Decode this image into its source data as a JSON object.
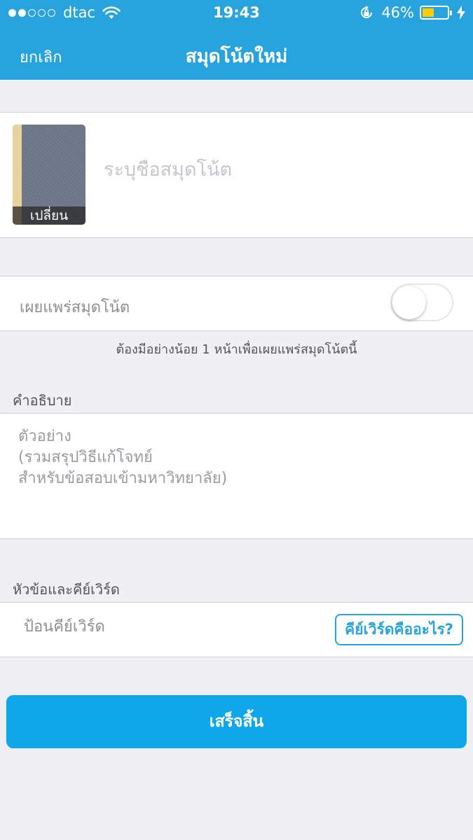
{
  "status_bar": {
    "carrier": "dtac",
    "time": "19:43",
    "battery_percent": "46%",
    "battery_level": 0.46,
    "signal_bars_filled": 2,
    "signal_bars_total": 5
  },
  "nav": {
    "cancel_label": "ยกเลิก",
    "title": "สมุดโน้ตใหม่"
  },
  "cover": {
    "change_label": "เปลี่ยน"
  },
  "notebook_name": {
    "value": "",
    "placeholder": "ระบุชื่อสมุดโน้ต"
  },
  "publish": {
    "label": "เผยแพร่สมุดโน้ต",
    "enabled": false,
    "hint": "ต้องมีอย่างน้อย 1 หน้าเพื่อเผยแพร่สมุดโน้ตนี้"
  },
  "description": {
    "header": "คำอธิบาย",
    "value": "",
    "placeholder": "ตัวอย่าง\n(รวมสรุปวิธีแก้โจทย์\nสำหรับข้อสอบเข้ามหาวิทยาลัย)"
  },
  "keywords": {
    "header": "หัวข้อและคีย์เวิร์ด",
    "value": "",
    "placeholder": "ป้อนคีย์เวิร์ด",
    "help_label": "คีย์เวิร์ดคืออะไร?"
  },
  "done_label": "เสร็จสิ้น",
  "colors": {
    "header_bg": "#27a3de",
    "button_bg": "#0fa6ea",
    "page_bg": "#efeff4",
    "battery": "#ffcc00"
  },
  "icons": [
    "wifi-icon",
    "rotation-lock-icon",
    "battery-icon",
    "charging-bolt-icon"
  ]
}
